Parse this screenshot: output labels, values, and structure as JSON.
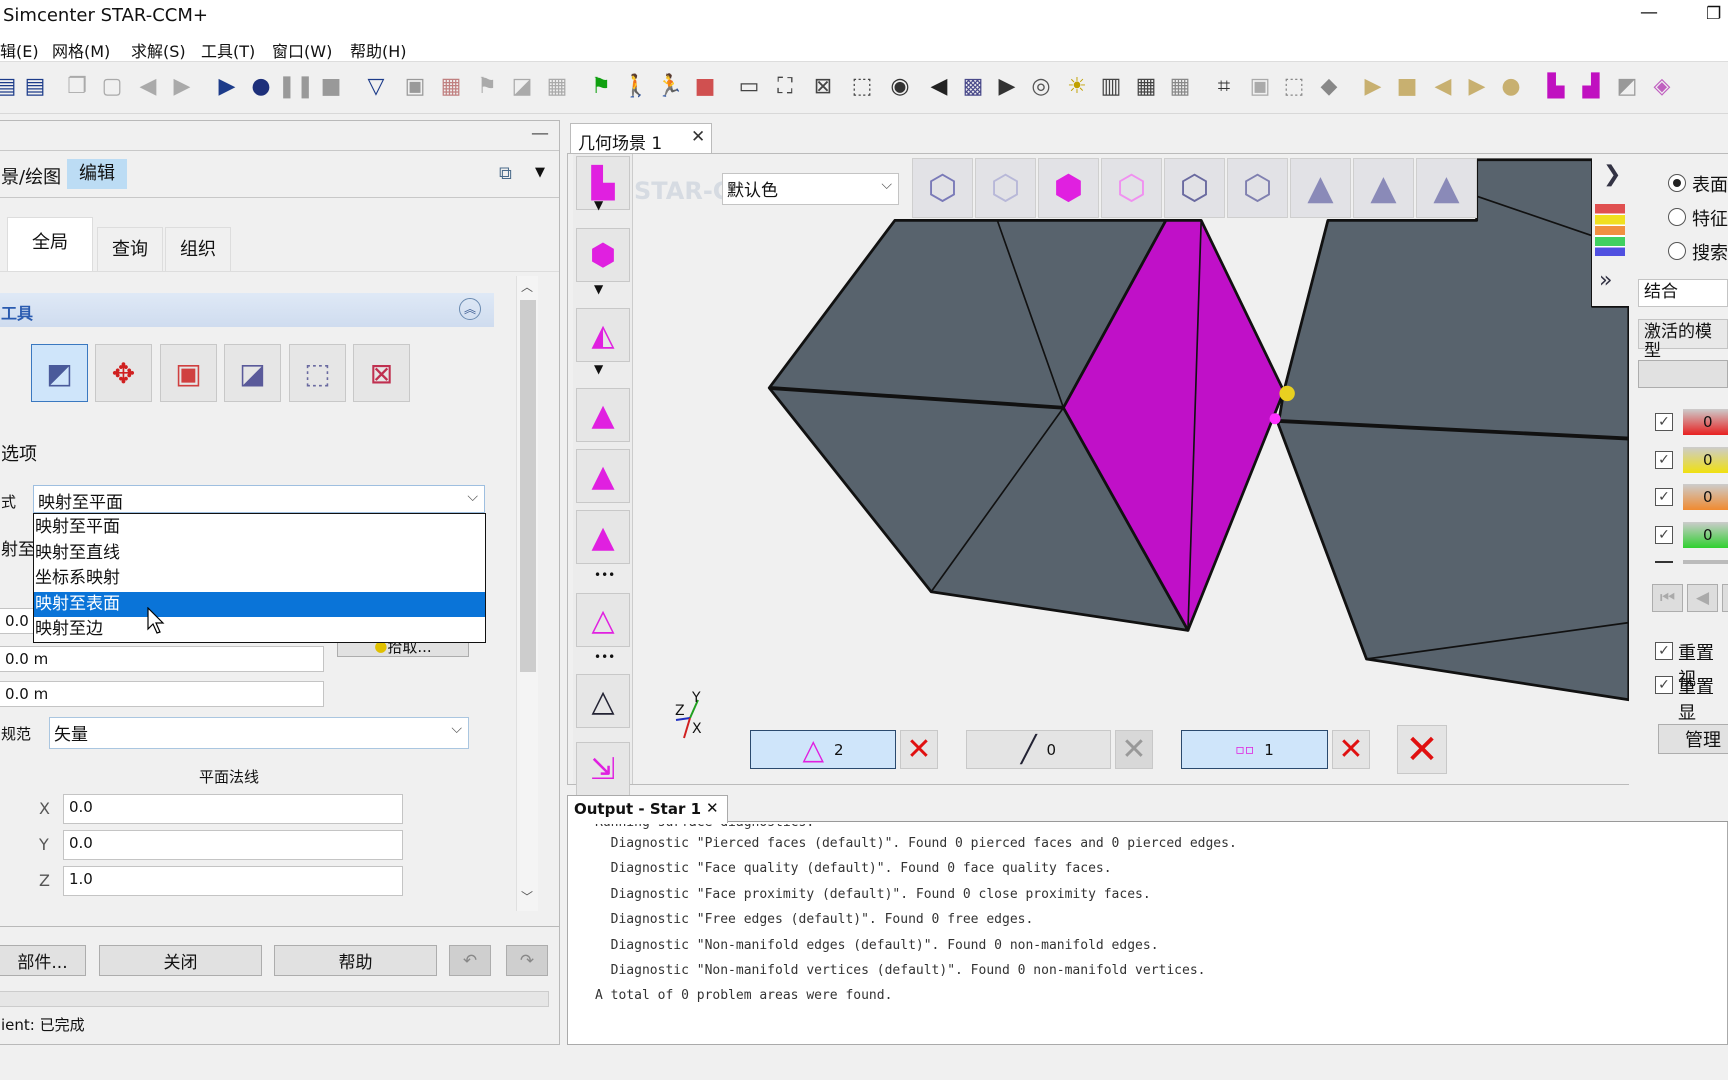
{
  "window": {
    "title": "Simcenter STAR-CCM+",
    "minimize_icon": "minimize-icon",
    "restore_icon": "restore-icon"
  },
  "menu": [
    "辑(E)",
    "网格(M)",
    "求解(S)",
    "工具(T)",
    "窗口(W)",
    "帮助(H)"
  ],
  "toolbar": {
    "icons": [
      {
        "name": "save-icon",
        "glyph": "▤",
        "color": "#1d3c8a"
      },
      {
        "name": "save-all-icon",
        "glyph": "▤",
        "color": "#1d3c8a"
      },
      {
        "name": "copy-icon",
        "glyph": "❐",
        "color": "#aaaaaa"
      },
      {
        "name": "paste-icon",
        "glyph": "▢",
        "color": "#aaaaaa"
      },
      {
        "name": "back-icon",
        "glyph": "◀",
        "color": "#aaaaaa"
      },
      {
        "name": "forward-icon",
        "glyph": "▶",
        "color": "#aaaaaa"
      },
      {
        "name": "run-icon",
        "glyph": "▶",
        "color": "#1d3c8a"
      },
      {
        "name": "record-icon",
        "glyph": "●",
        "color": "#1d2f7a"
      },
      {
        "name": "pause-icon",
        "glyph": "❚❚",
        "color": "#999999"
      },
      {
        "name": "stop-icon",
        "glyph": "■",
        "color": "#999999"
      },
      {
        "name": "surface-mesh-icon",
        "glyph": "▽",
        "color": "#1d3c8a"
      },
      {
        "name": "mesh-icon",
        "glyph": "▣",
        "color": "#999999"
      },
      {
        "name": "clear-mesh-icon",
        "glyph": "▦",
        "color": "#c08080"
      },
      {
        "name": "flag-gray-icon",
        "glyph": "⚑",
        "color": "#aaaaaa"
      },
      {
        "name": "sheet-icon",
        "glyph": "◪",
        "color": "#aaaaaa"
      },
      {
        "name": "volume-icon",
        "glyph": "▦",
        "color": "#aaaaaa"
      },
      {
        "name": "flag-icon",
        "glyph": "⚑",
        "color": "#10a010"
      },
      {
        "name": "walk-icon",
        "glyph": "🚶",
        "color": "#222222"
      },
      {
        "name": "run-man-icon",
        "glyph": "🏃",
        "color": "#222222"
      },
      {
        "name": "stop-red-icon",
        "glyph": "■",
        "color": "#d05050"
      },
      {
        "name": "scene-icon",
        "glyph": "▭",
        "color": "#444444"
      },
      {
        "name": "fit-icon",
        "glyph": "⛶",
        "color": "#444444"
      },
      {
        "name": "reset-view-icon",
        "glyph": "⊠",
        "color": "#444444"
      },
      {
        "name": "select-icon",
        "glyph": "⬚",
        "color": "#444444"
      },
      {
        "name": "camera-icon",
        "glyph": "◉",
        "color": "#333333"
      },
      {
        "name": "arrow-left-icon",
        "glyph": "◀",
        "color": "#222222"
      },
      {
        "name": "transform-icon",
        "glyph": "▩",
        "color": "#4a4a8a"
      },
      {
        "name": "arrow-right-icon",
        "glyph": "▶",
        "color": "#333333"
      },
      {
        "name": "sphere-icon",
        "glyph": "◎",
        "color": "#555555"
      },
      {
        "name": "light-icon",
        "glyph": "☀",
        "color": "#c0a000"
      },
      {
        "name": "ruler-icon",
        "glyph": "▥",
        "color": "#444444"
      },
      {
        "name": "grid-icon",
        "glyph": "▦",
        "color": "#444444"
      },
      {
        "name": "grid2-icon",
        "glyph": "▦",
        "color": "#888888"
      },
      {
        "name": "plot-icon",
        "glyph": "⌗",
        "color": "#333333"
      },
      {
        "name": "plot2-icon",
        "glyph": "▣",
        "color": "#aaaaaa"
      },
      {
        "name": "plot3-icon",
        "glyph": "⬚",
        "color": "#888888"
      },
      {
        "name": "plot4-icon",
        "glyph": "◆",
        "color": "#888888"
      },
      {
        "name": "play-icon",
        "glyph": "▶",
        "color": "#c8b070"
      },
      {
        "name": "stop-anim-icon",
        "glyph": "■",
        "color": "#c8b070"
      },
      {
        "name": "step-back-icon",
        "glyph": "◀",
        "color": "#c8b070"
      },
      {
        "name": "step-forward-icon",
        "glyph": "▶",
        "color": "#c8b070"
      },
      {
        "name": "record-anim-icon",
        "glyph": "●",
        "color": "#c8b070"
      },
      {
        "name": "layout-icon",
        "glyph": "▙",
        "color": "#c010c0"
      },
      {
        "name": "layout2-icon",
        "glyph": "▟",
        "color": "#c010c0"
      },
      {
        "name": "layout3-icon",
        "glyph": "◩",
        "color": "#999999"
      },
      {
        "name": "layout4-icon",
        "glyph": "◈",
        "color": "#c060c0"
      }
    ]
  },
  "left_panel": {
    "minimize_label": "—",
    "breadcrumb": {
      "path": "景/绘图",
      "edit": "编辑"
    },
    "tabs": [
      "全局",
      "查询",
      "组织"
    ],
    "tools_section": {
      "title": "工具",
      "buttons": [
        "project-icon",
        "translate-icon",
        "extrude-icon",
        "imprint-icon",
        "boolean-icon",
        "delete-part-icon"
      ]
    },
    "options_label": "选项",
    "mode_label": "式",
    "mode_value": "映射至平面",
    "dropdown_options": [
      "映射至平面",
      "映射至直线",
      "坐标系映射",
      "映射至表面",
      "映射至边"
    ],
    "dropdown_highlighted": 3,
    "hidden_label": "射至平",
    "fields": [
      "0.0 m",
      "0.0 m",
      "0.0 m"
    ],
    "pick_button": "拾取...",
    "spec_label": "规范",
    "spec_value": "矢量",
    "normal_label": "平面法线",
    "normal": [
      {
        "axis": "X",
        "value": "0.0"
      },
      {
        "axis": "Y",
        "value": "0.0"
      },
      {
        "axis": "Z",
        "value": "1.0"
      }
    ],
    "footer": {
      "parts": "部件...",
      "close": "关闭",
      "help": "帮助"
    },
    "status": "ient: 已完成"
  },
  "scene": {
    "tab_label": "几何场景 1",
    "watermark": "STAR-C",
    "color_mode": "默认色",
    "colors": {
      "face": "#58636d",
      "selected": "#c010c8",
      "background": "#f0f0f0"
    },
    "selection": {
      "faces": "2",
      "edges": "0",
      "vertices": "1"
    },
    "axes": {
      "x": "X",
      "y": "Y",
      "z": "Z"
    }
  },
  "right_panel": {
    "radios": [
      {
        "label": "表面",
        "checked": true
      },
      {
        "label": "特征",
        "checked": false
      },
      {
        "label": "搜索",
        "checked": false
      }
    ],
    "combine": "结合",
    "active_model": "激活的模型",
    "bars": [
      {
        "value": "0",
        "color": "#e82020"
      },
      {
        "value": "0",
        "color": "#f0e010"
      },
      {
        "value": "0",
        "color": "#f08a30"
      },
      {
        "value": "0",
        "color": "#30d030"
      }
    ],
    "checks": [
      "重置视",
      "重置显"
    ],
    "manage": "管理"
  },
  "output": {
    "tab_label": "Output - Star 1",
    "lines": [
      "Running surface diagnostics.",
      "  Diagnostic \"Pierced faces (default)\". Found 0 pierced faces and 0 pierced edges.",
      "  Diagnostic \"Face quality (default)\". Found 0 face quality faces.",
      "  Diagnostic \"Face proximity (default)\". Found 0 close proximity faces.",
      "  Diagnostic \"Free edges (default)\". Found 0 free edges.",
      "  Diagnostic \"Non-manifold edges (default)\". Found 0 non-manifold edges.",
      "  Diagnostic \"Non-manifold vertices (default)\". Found 0 non-manifold vertices.",
      "A total of 0 problem areas were found."
    ]
  }
}
